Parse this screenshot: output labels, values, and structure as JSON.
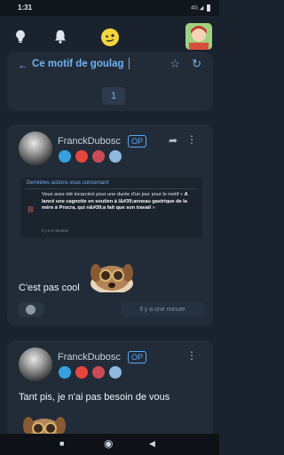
{
  "status_bar": {
    "time": "1:31",
    "network": "4G",
    "signal": "◢"
  },
  "top_bar": {
    "icons": [
      "lightbulb-icon",
      "bell-icon",
      "smiley-icon"
    ],
    "profile": "profile-avatar"
  },
  "topic_nav": {
    "back_icon": "←",
    "title": "Ce motif de goulag",
    "star_icon": "☆",
    "refresh_icon": "↻",
    "current_page": "1"
  },
  "posts": [
    {
      "author": "FranckDubosc",
      "op": "OP",
      "badges": [
        "star-badge",
        "fire-badge",
        "wheel-badge",
        "portrait-badge"
      ],
      "notice": {
        "header": "Dernières actions vous concernant",
        "text_before": "Vous avez été incarcéré pour une durée d'un jour pour le motif « ",
        "text_bold": "A lancé une cagnotte en soutien à l&#39;anneau gastrique de la mère à Procra, qui n&#39;a fait que son travail",
        "text_after": " »",
        "ago": "Il y a 2 minutes"
      },
      "text": "C'est pas cool",
      "sticker": "dog-with-goggles-sticker",
      "time": "Il y a une minute"
    },
    {
      "author": "FranckDubosc",
      "op": "OP",
      "badges": [
        "star-badge",
        "fire-badge",
        "wheel-badge",
        "portrait-badge"
      ],
      "text": "Tant pis, je n'ai pas besoin de vous",
      "sticker": "dog-with-goggles-sticker"
    }
  ],
  "nav_bar": {
    "square": "■",
    "circle": "◉",
    "back": "◀"
  },
  "colors": {
    "accent": "#6fb2f2",
    "background": "#1a222d",
    "card": "#222c38"
  }
}
